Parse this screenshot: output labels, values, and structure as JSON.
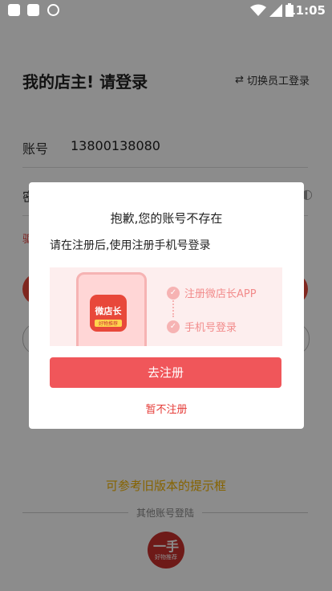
{
  "status_bar": {
    "time": "11:05"
  },
  "login": {
    "title": "我的店主! 请登录",
    "switch_label": "切换员工登录",
    "account_label": "账号",
    "account_value": "13800138080",
    "password_label_partial": "密",
    "forgot_partial": "?",
    "link_partial": "驱"
  },
  "footer": {
    "reference_text": "可参考旧版本的提示框",
    "other_login_label": "其他账号登陆",
    "avatar_main": "一手",
    "avatar_sub": "好物推荐"
  },
  "dialog": {
    "title": "抱歉,您的账号不存在",
    "subtitle": "请在注册后,使用注册手机号登录",
    "illustration": {
      "app_name": "微店长",
      "app_tag": "好物推荐",
      "step1": "注册微店长APP",
      "step2": "手机号登录"
    },
    "register_button": "去注册",
    "skip_link": "暂不注册"
  },
  "colors": {
    "accent": "#f0565a",
    "link": "#e53935",
    "highlight": "#f4b400"
  }
}
